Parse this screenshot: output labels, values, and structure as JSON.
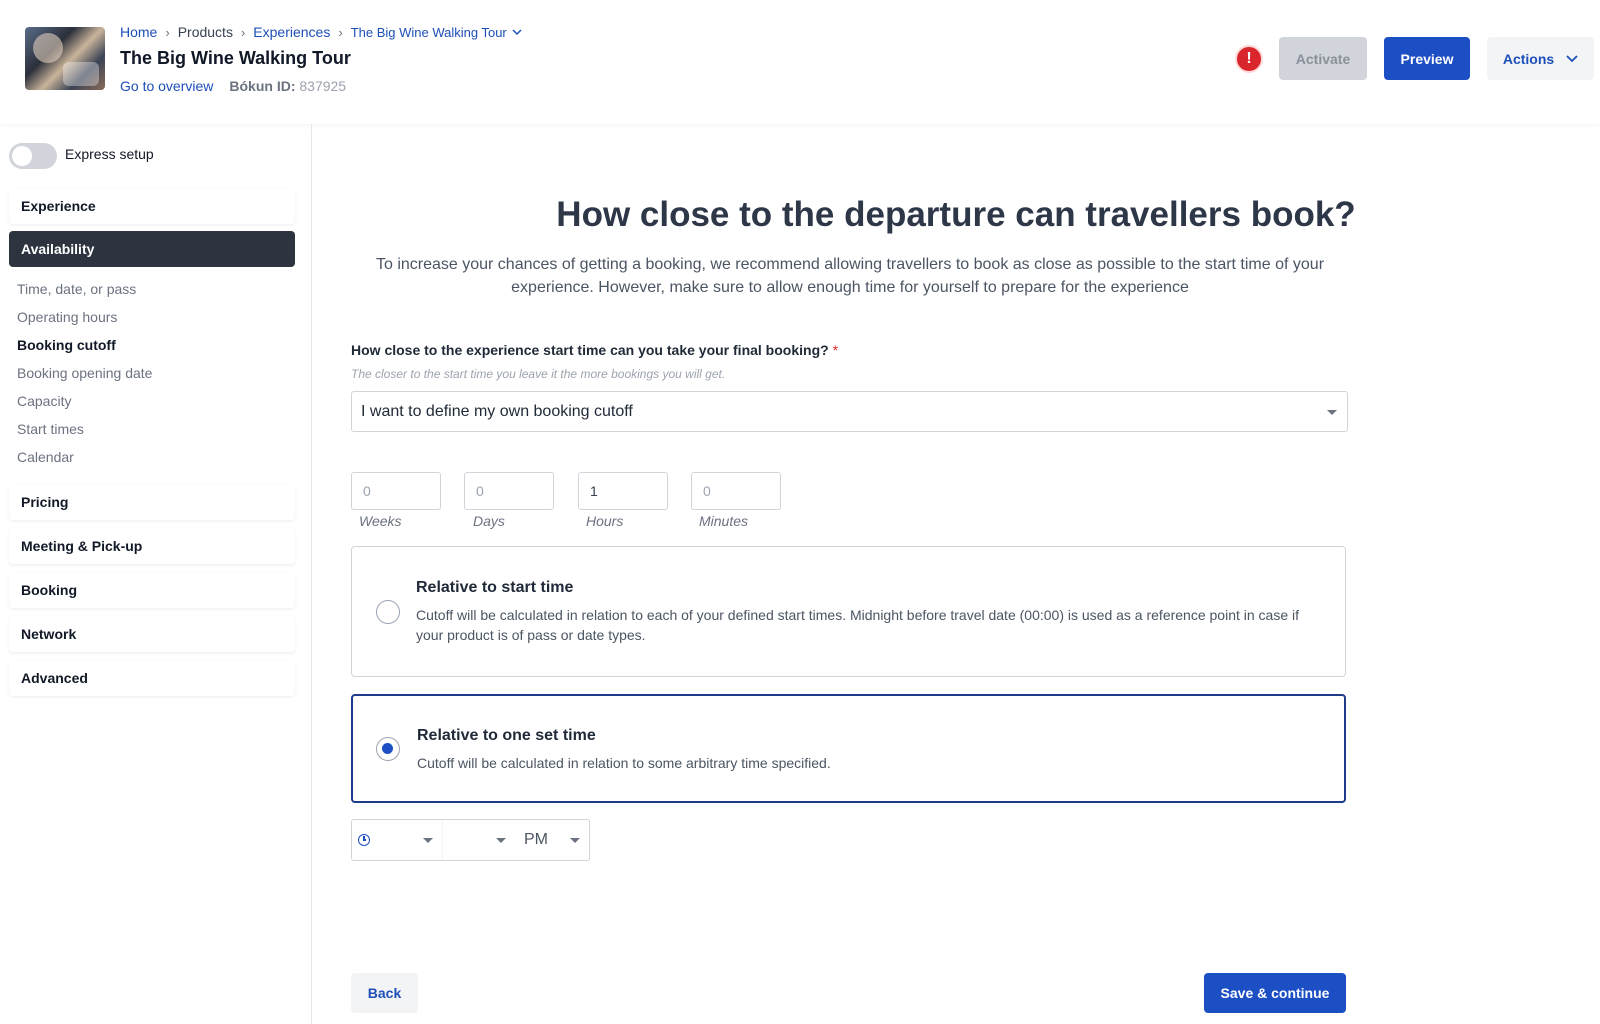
{
  "header": {
    "breadcrumbs": {
      "home": "Home",
      "products": "Products",
      "experiences": "Experiences",
      "current": "The Big Wine Walking Tour"
    },
    "title": "The Big Wine Walking Tour",
    "go_to_overview": "Go to overview",
    "bokun_id_label": "Bókun ID:",
    "bokun_id_value": "837925",
    "warning_glyph": "!",
    "activate_label": "Activate",
    "preview_label": "Preview",
    "actions_label": "Actions"
  },
  "sidebar": {
    "express_setup_label": "Express setup",
    "express_setup_on": false,
    "sections": {
      "experience": "Experience",
      "availability": "Availability",
      "pricing": "Pricing",
      "meeting": "Meeting & Pick-up",
      "booking": "Booking",
      "network": "Network",
      "advanced": "Advanced"
    },
    "availability_items": [
      "Time, date, or pass",
      "Operating hours",
      "Booking cutoff",
      "Booking opening date",
      "Capacity",
      "Start times",
      "Calendar"
    ],
    "active_item": "Booking cutoff"
  },
  "main": {
    "heading": "How close to the departure can travellers book?",
    "intro": "To increase your chances of getting a booking, we recommend allowing travellers to book as close as possible to the start time of your experience. However, make sure to allow enough time for yourself to prepare for the experience",
    "question_label": "How close to the experience start time can you take your final booking?",
    "required_mark": "*",
    "question_help": "The closer to the start time you leave it the more bookings you will get.",
    "cutoff_select_value": "I want to define my own booking cutoff",
    "duration": {
      "weeks": {
        "value": "0",
        "label": "Weeks"
      },
      "days": {
        "value": "0",
        "label": "Days"
      },
      "hours": {
        "value": "1",
        "label": "Hours"
      },
      "minutes": {
        "value": "0",
        "label": "Minutes"
      }
    },
    "options": {
      "start_time": {
        "title": "Relative to start time",
        "description": "Cutoff will be calculated in relation to each of your defined start times. Midnight before travel date (00:00) is used as a reference point in case if your product is of pass or date types.",
        "selected": false
      },
      "set_time": {
        "title": "Relative to one set time",
        "description": "Cutoff will be calculated in relation to some arbitrary time specified.",
        "selected": true
      }
    },
    "time_picker": {
      "hour": "",
      "minute": "",
      "ampm": "PM"
    },
    "back_label": "Back",
    "save_label": "Save & continue"
  },
  "colors": {
    "primary": "#1c4ec4",
    "sidebar_active": "#2d333f",
    "warning": "#d9262c"
  }
}
